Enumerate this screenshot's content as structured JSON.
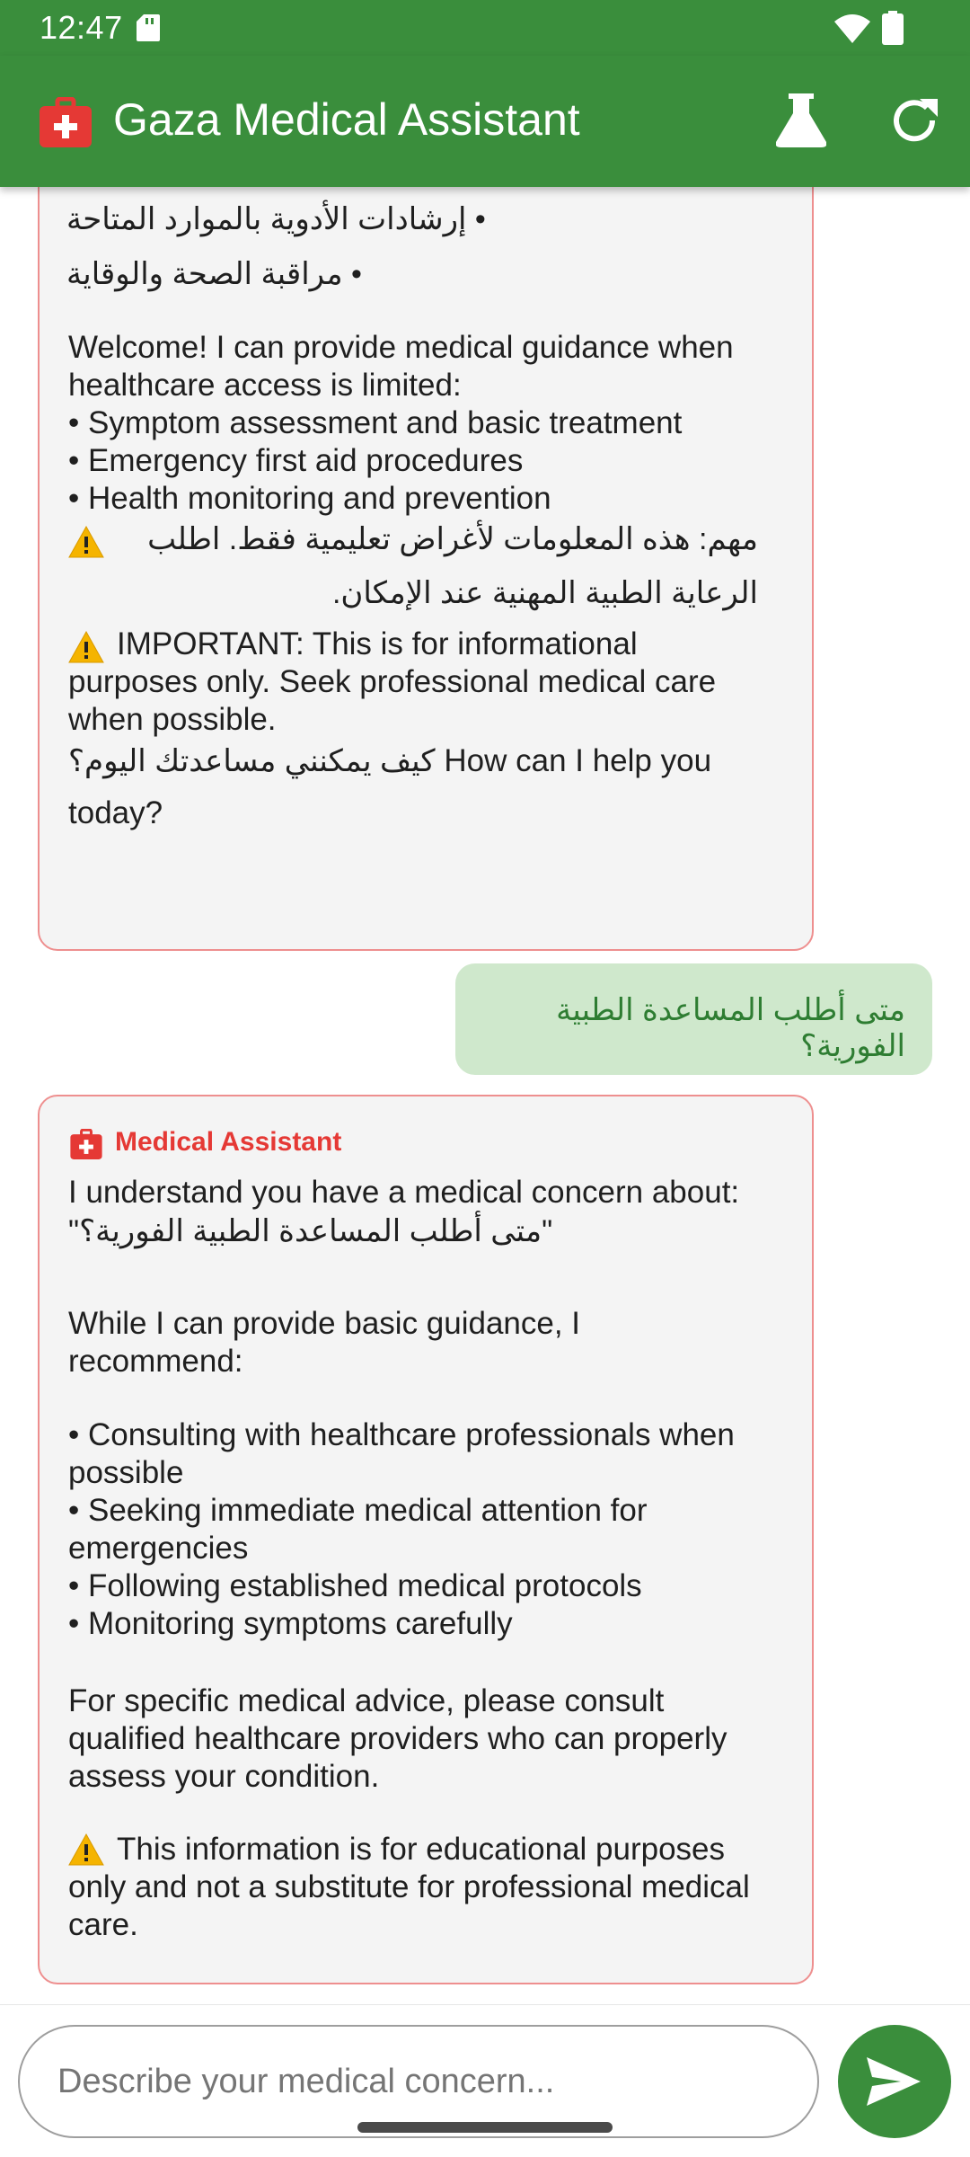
{
  "status_bar": {
    "time": "12:47"
  },
  "app_bar": {
    "title": "Gaza Medical Assistant",
    "colors": {
      "primary": "#3a8e3c",
      "accent_red": "#e53935"
    },
    "icons": [
      "medical-kit-icon",
      "flask-icon",
      "refresh-icon"
    ]
  },
  "messages": {
    "welcome": {
      "ar_bullet_1": "• إرشادات الأدوية بالموارد المتاحة",
      "ar_bullet_2": "• مراقبة الصحة والوقاية",
      "en_intro": "Welcome! I can provide medical guidance when healthcare access is limited:",
      "en_bullets": "• Symptom assessment and basic treatment\n• Emergency first aid procedures\n• Health monitoring and prevention",
      "ar_important": "مهم: هذه المعلومات لأغراض تعليمية فقط. اطلب الرعاية الطبية المهنية عند الإمكان.",
      "en_important": "IMPORTANT: This is for informational purposes only. Seek professional medical care when possible.",
      "closing_ar": "كيف يمكنني مساعدتك اليوم؟",
      "closing_en": "How can I help you today?"
    },
    "user_message": "متى أطلب المساعدة الطبية الفورية؟",
    "reply": {
      "sender": "Medical Assistant",
      "line_1": "I understand you have a medical concern about:",
      "quoted": "\"متى أطلب المساعدة الطبية الفورية؟\"",
      "recommend": "While I can provide basic guidance, I recommend:",
      "bullets": "• Consulting with healthcare professionals when possible\n• Seeking immediate medical attention for emergencies\n• Following established medical protocols\n• Monitoring symptoms carefully",
      "consult": "For specific medical advice, please consult qualified healthcare providers who can properly assess your condition.",
      "disclaimer": "This information is for educational purposes only and not a substitute for professional medical care."
    }
  },
  "input": {
    "placeholder": "Describe your medical concern..."
  }
}
